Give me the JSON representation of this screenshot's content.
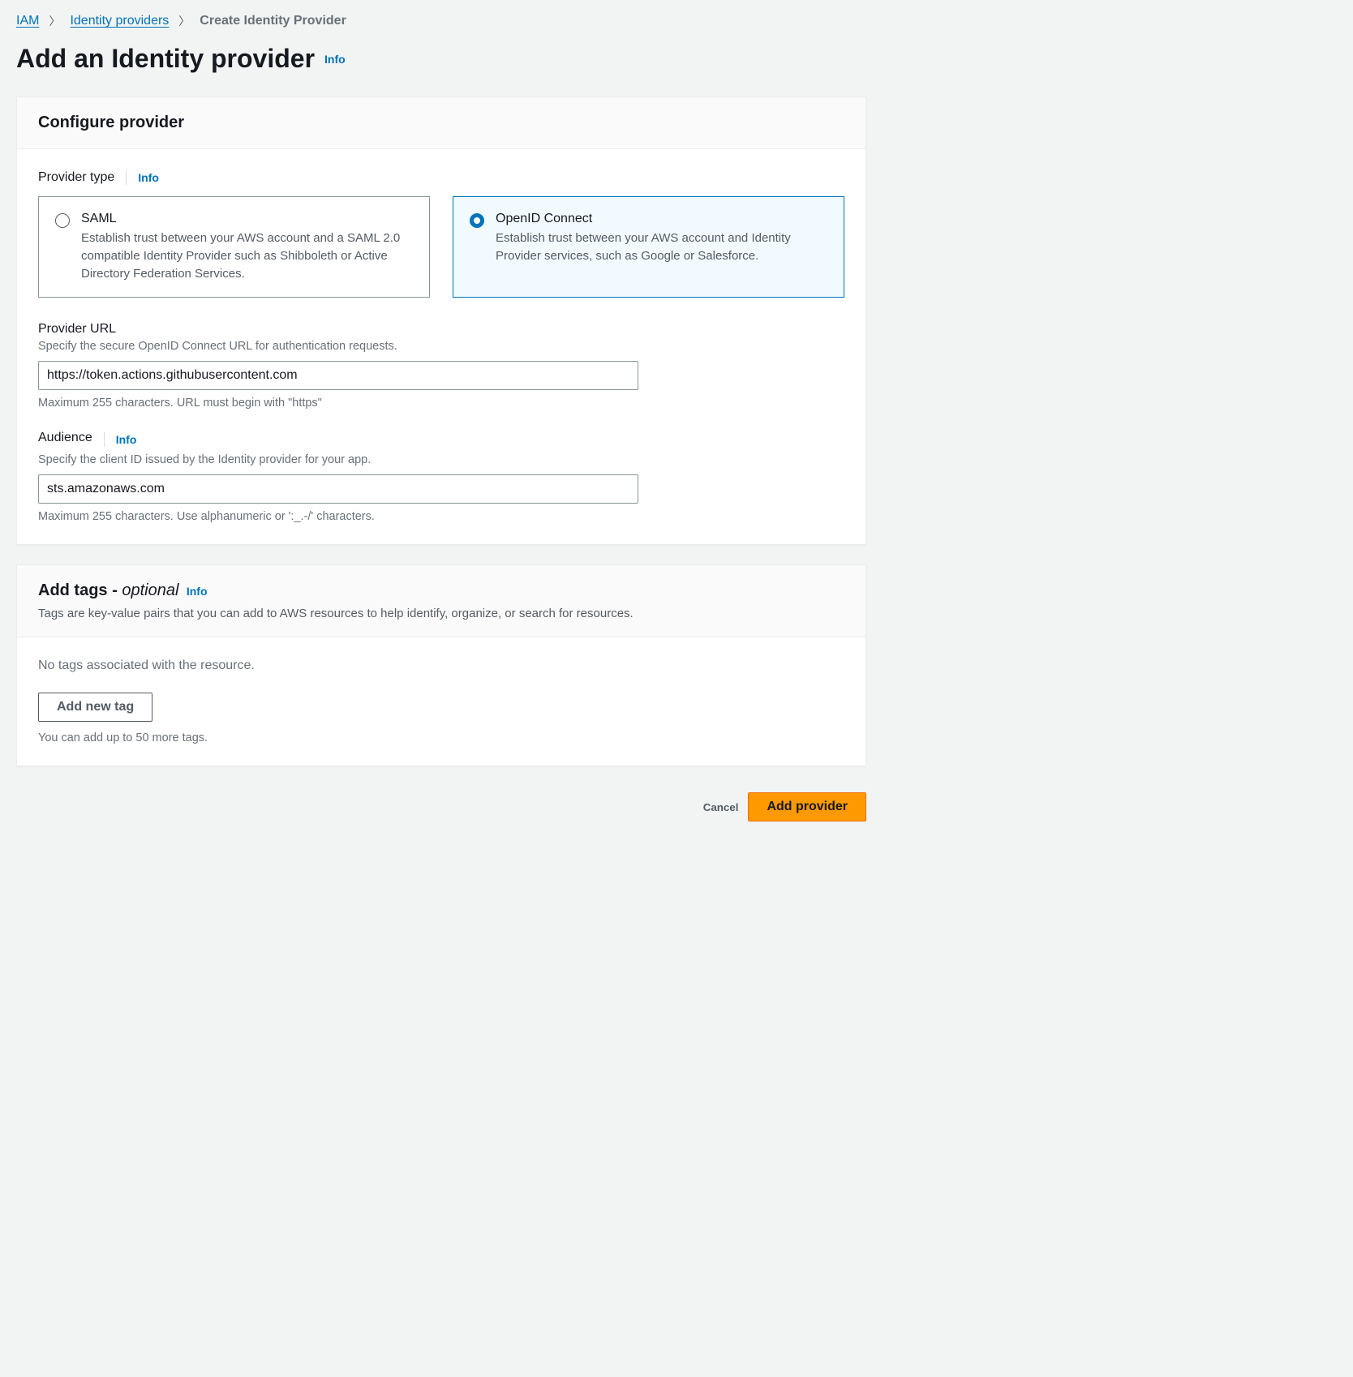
{
  "breadcrumb": {
    "root": "IAM",
    "section": "Identity providers",
    "current": "Create Identity Provider"
  },
  "page": {
    "title": "Add an Identity provider",
    "info": "Info"
  },
  "configure": {
    "title": "Configure provider",
    "provider_type_label": "Provider type",
    "info": "Info",
    "types": [
      {
        "name": "SAML",
        "desc": "Establish trust between your AWS account and a SAML 2.0 compatible Identity Provider such as Shibboleth or Active Directory Federation Services."
      },
      {
        "name": "OpenID Connect",
        "desc": "Establish trust between your AWS account and Identity Provider services, such as Google or Salesforce."
      }
    ]
  },
  "provider_url": {
    "label": "Provider URL",
    "desc": "Specify the secure OpenID Connect URL for authentication requests.",
    "value": "https://token.actions.githubusercontent.com",
    "hint": "Maximum 255 characters. URL must begin with \"https\""
  },
  "audience": {
    "label": "Audience",
    "info": "Info",
    "desc": "Specify the client ID issued by the Identity provider for your app.",
    "value": "sts.amazonaws.com",
    "hint": "Maximum 255 characters. Use alphanumeric or ':_.-/' characters."
  },
  "tags": {
    "title_prefix": "Add tags - ",
    "title_suffix": "optional",
    "info": "Info",
    "desc": "Tags are key-value pairs that you can add to AWS resources to help identify, organize, or search for resources.",
    "status": "No tags associated with the resource.",
    "add_button": "Add new tag",
    "hint": "You can add up to 50 more tags."
  },
  "footer": {
    "cancel": "Cancel",
    "submit": "Add provider"
  }
}
